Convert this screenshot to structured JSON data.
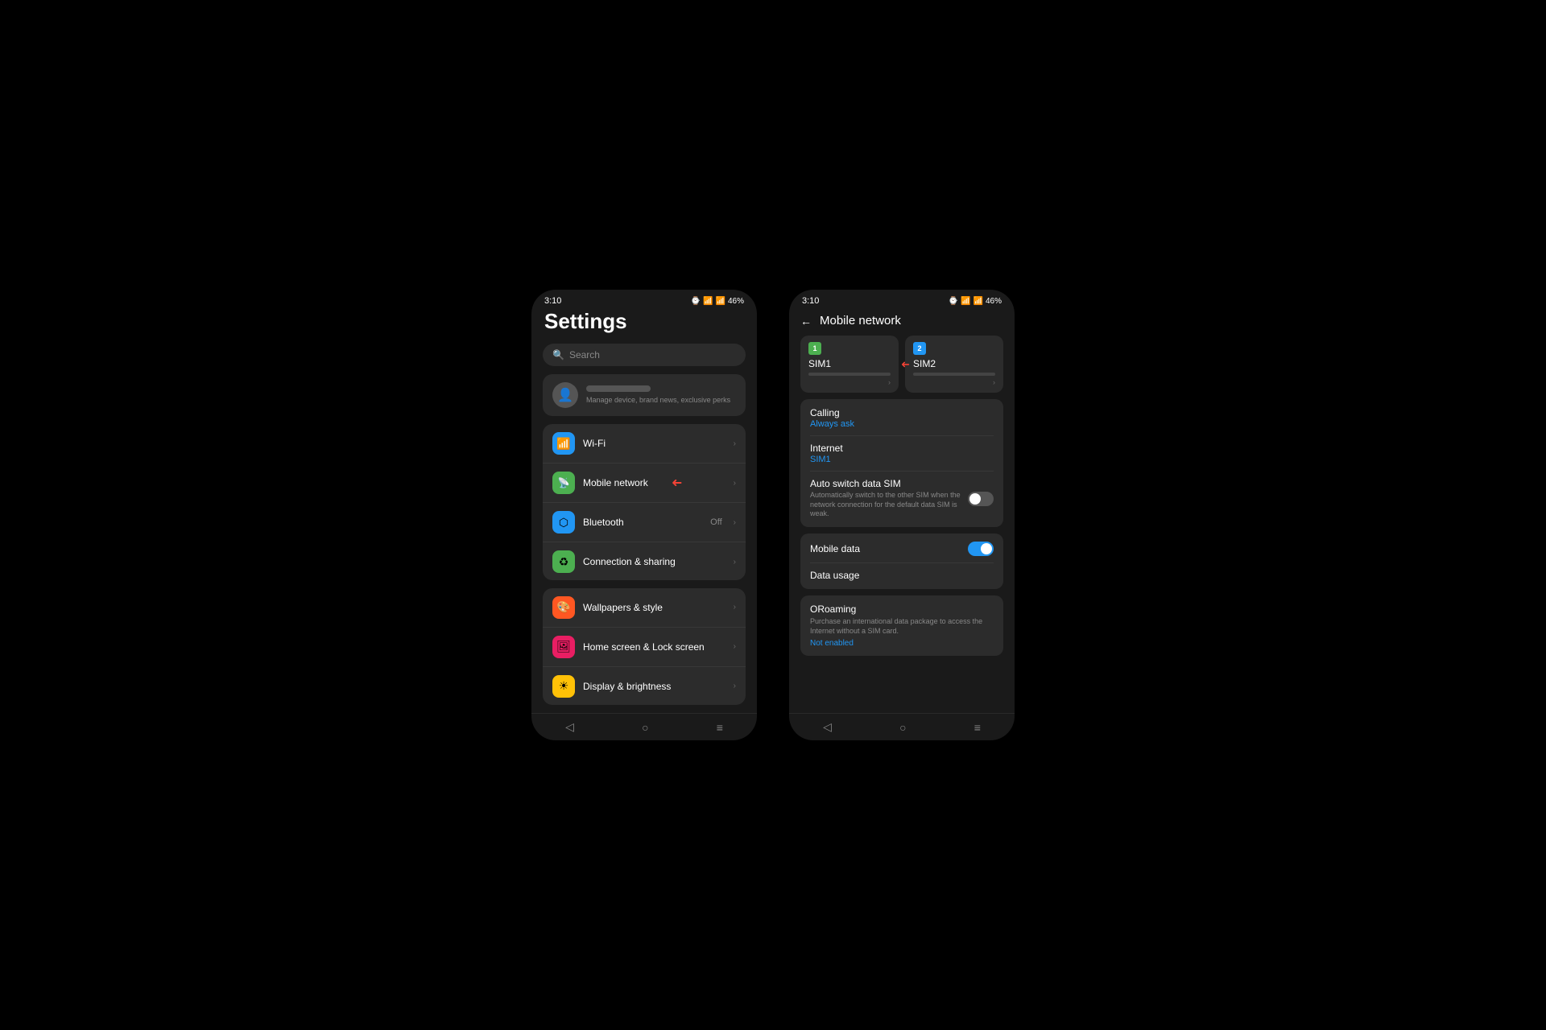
{
  "phone1": {
    "statusBar": {
      "time": "3:10",
      "battery": "46%",
      "icons": "📶📶"
    },
    "title": "Settings",
    "search": {
      "placeholder": "Search"
    },
    "profile": {
      "subText": "Manage device, brand news, exclusive perks"
    },
    "groups": [
      {
        "items": [
          {
            "icon": "wifi",
            "label": "Wi-Fi",
            "value": "",
            "hasArrow": true
          },
          {
            "icon": "mobile",
            "label": "Mobile network",
            "value": "",
            "hasArrow": true,
            "hasRedArrow": true
          },
          {
            "icon": "bluetooth",
            "label": "Bluetooth",
            "value": "Off",
            "hasArrow": true
          },
          {
            "icon": "sharing",
            "label": "Connection & sharing",
            "value": "",
            "hasArrow": true
          }
        ]
      },
      {
        "items": [
          {
            "icon": "wallpaper",
            "label": "Wallpapers & style",
            "value": "",
            "hasArrow": true
          },
          {
            "icon": "homescreen",
            "label": "Home screen & Lock screen",
            "value": "",
            "hasArrow": true
          },
          {
            "icon": "display",
            "label": "Display & brightness",
            "value": "",
            "hasArrow": true
          }
        ]
      }
    ],
    "navBar": {
      "back": "◁",
      "home": "○",
      "menu": "≡"
    }
  },
  "phone2": {
    "statusBar": {
      "time": "3:10",
      "battery": "46%"
    },
    "header": {
      "back": "←",
      "title": "Mobile network"
    },
    "sim1": {
      "badge": "1",
      "label": "SIM1",
      "arrow": "›"
    },
    "sim2": {
      "badge": "2",
      "label": "SIM2",
      "arrow": "›"
    },
    "calling": {
      "label": "Calling",
      "value": "Always ask"
    },
    "internet": {
      "label": "Internet",
      "value": "SIM1"
    },
    "autoSwitch": {
      "label": "Auto switch data SIM",
      "sub": "Automatically switch to the other SIM when the network connection for the default data SIM is weak.",
      "enabled": false
    },
    "mobileData": {
      "label": "Mobile data",
      "enabled": true
    },
    "dataUsage": {
      "label": "Data usage"
    },
    "oroaming": {
      "label": "ORoaming",
      "sub": "Purchase an international data package to access the Internet without a SIM card.",
      "status": "Not enabled"
    },
    "navBar": {
      "back": "◁",
      "home": "○",
      "menu": "≡"
    }
  }
}
